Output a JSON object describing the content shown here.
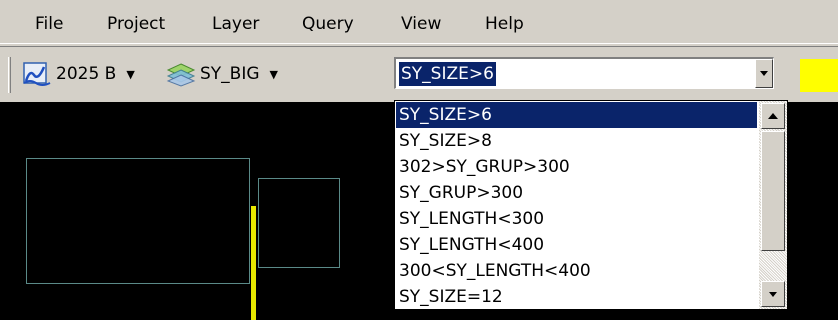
{
  "menu": {
    "items": [
      {
        "label": "File"
      },
      {
        "label": "Project"
      },
      {
        "label": "Layer"
      },
      {
        "label": "Query"
      },
      {
        "label": "View"
      },
      {
        "label": "Help"
      }
    ]
  },
  "toolbar": {
    "survey": {
      "label": "2025 B",
      "icon": "river-map-icon"
    },
    "layer": {
      "label": "SY_BIG",
      "icon": "layers-icon"
    },
    "query_combo": {
      "value": "SY_SIZE>6"
    },
    "highlight_color": "#ffff00"
  },
  "query_dropdown": {
    "options": [
      "SY_SIZE>6",
      "SY_SIZE>8",
      "302>SY_GRUP>300",
      "SY_GRUP>300",
      "SY_LENGTH<300",
      "SY_LENGTH<400",
      "300<SY_LENGTH<400",
      "SY_SIZE=12"
    ],
    "selected_index": 0
  },
  "colors": {
    "selection": "#0a246a",
    "map_outline": "#5a8a88",
    "map_feature": "#e8e800"
  }
}
